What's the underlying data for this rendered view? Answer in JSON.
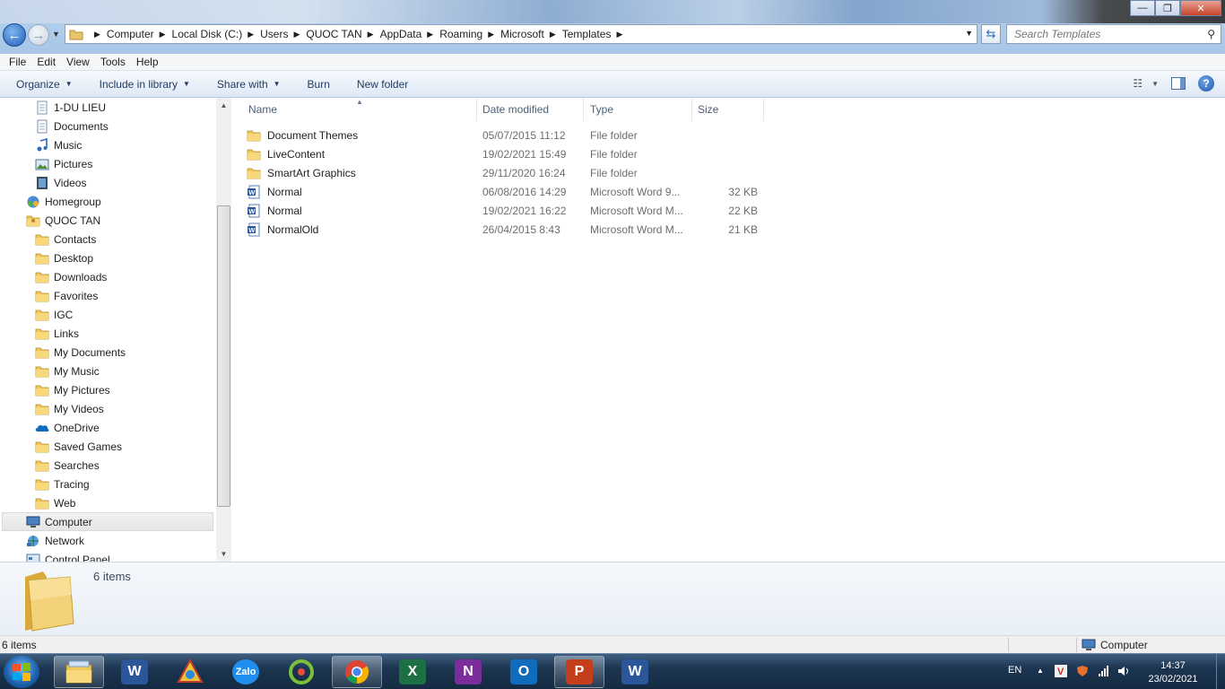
{
  "window": {
    "buttons": {
      "minimize": "—",
      "maximize": "❐",
      "close": "✕"
    }
  },
  "address": {
    "crumbs": [
      "Computer",
      "Local Disk (C:)",
      "Users",
      "QUOC TAN",
      "AppData",
      "Roaming",
      "Microsoft",
      "Templates"
    ]
  },
  "search": {
    "placeholder": "Search Templates"
  },
  "menu": [
    "File",
    "Edit",
    "View",
    "Tools",
    "Help"
  ],
  "commands": {
    "organize": "Organize",
    "include_in_library": "Include in library",
    "share_with": "Share with",
    "burn": "Burn",
    "new_folder": "New folder"
  },
  "nav": {
    "items": [
      {
        "label": "1-DU LIEU",
        "icon": "library-doc-icon",
        "indent": 2
      },
      {
        "label": "Documents",
        "icon": "documents-library-icon",
        "indent": 2
      },
      {
        "label": "Music",
        "icon": "music-library-icon",
        "indent": 2
      },
      {
        "label": "Pictures",
        "icon": "pictures-library-icon",
        "indent": 2
      },
      {
        "label": "Videos",
        "icon": "videos-library-icon",
        "indent": 2
      },
      {
        "label": "Homegroup",
        "icon": "homegroup-icon",
        "indent": 1
      },
      {
        "label": "QUOC TAN",
        "icon": "user-folder-icon",
        "indent": 1
      },
      {
        "label": "Contacts",
        "icon": "contacts-folder-icon",
        "indent": 2
      },
      {
        "label": "Desktop",
        "icon": "desktop-folder-icon",
        "indent": 2
      },
      {
        "label": "Downloads",
        "icon": "downloads-folder-icon",
        "indent": 2
      },
      {
        "label": "Favorites",
        "icon": "favorites-folder-icon",
        "indent": 2
      },
      {
        "label": "IGC",
        "icon": "folder-icon",
        "indent": 2
      },
      {
        "label": "Links",
        "icon": "links-folder-icon",
        "indent": 2
      },
      {
        "label": "My Documents",
        "icon": "my-documents-folder-icon",
        "indent": 2
      },
      {
        "label": "My Music",
        "icon": "my-music-folder-icon",
        "indent": 2
      },
      {
        "label": "My Pictures",
        "icon": "my-pictures-folder-icon",
        "indent": 2
      },
      {
        "label": "My Videos",
        "icon": "my-videos-folder-icon",
        "indent": 2
      },
      {
        "label": "OneDrive",
        "icon": "onedrive-icon",
        "indent": 2
      },
      {
        "label": "Saved Games",
        "icon": "saved-games-folder-icon",
        "indent": 2
      },
      {
        "label": "Searches",
        "icon": "searches-folder-icon",
        "indent": 2
      },
      {
        "label": "Tracing",
        "icon": "folder-icon",
        "indent": 2
      },
      {
        "label": "Web",
        "icon": "folder-icon",
        "indent": 2
      },
      {
        "label": "Computer",
        "icon": "computer-icon",
        "indent": 1,
        "selected": true
      },
      {
        "label": "Network",
        "icon": "network-icon",
        "indent": 1
      },
      {
        "label": "Control Panel",
        "icon": "control-panel-icon",
        "indent": 1
      }
    ]
  },
  "columns": {
    "name": "Name",
    "date": "Date modified",
    "type": "Type",
    "size": "Size"
  },
  "files": [
    {
      "name": "Document Themes",
      "date": "05/07/2015 11:12",
      "type": "File folder",
      "size": "",
      "icon": "folder-icon"
    },
    {
      "name": "LiveContent",
      "date": "19/02/2021 15:49",
      "type": "File folder",
      "size": "",
      "icon": "folder-icon"
    },
    {
      "name": "SmartArt Graphics",
      "date": "29/11/2020 16:24",
      "type": "File folder",
      "size": "",
      "icon": "folder-icon"
    },
    {
      "name": "Normal",
      "date": "06/08/2016 14:29",
      "type": "Microsoft Word 9...",
      "size": "32 KB",
      "icon": "word-document-icon"
    },
    {
      "name": "Normal",
      "date": "19/02/2021 16:22",
      "type": "Microsoft Word M...",
      "size": "22 KB",
      "icon": "word-document-icon"
    },
    {
      "name": "NormalOld",
      "date": "26/04/2015 8:43",
      "type": "Microsoft Word M...",
      "size": "21 KB",
      "icon": "word-document-icon"
    }
  ],
  "details": {
    "count": "6 items"
  },
  "status": {
    "left": "6 items",
    "right": "Computer"
  },
  "taskbar": {
    "apps": [
      {
        "name": "explorer",
        "icon": "explorer-icon",
        "active": true
      },
      {
        "name": "word-pinned",
        "icon": "word-icon",
        "letter": "W",
        "color": "#2b579a"
      },
      {
        "name": "unikey",
        "icon": "unikey-icon",
        "letter": "",
        "color": "#e8c23a"
      },
      {
        "name": "zalo",
        "icon": "zalo-icon",
        "letter": "Zalo",
        "color": "#1f8ef1"
      },
      {
        "name": "app-green",
        "icon": "green-app-icon",
        "letter": "",
        "color": "#7cbf3a"
      },
      {
        "name": "chrome",
        "icon": "chrome-icon",
        "active": true
      },
      {
        "name": "excel",
        "icon": "excel-icon",
        "letter": "X",
        "color": "#1d7044"
      },
      {
        "name": "onenote",
        "icon": "onenote-icon",
        "letter": "N",
        "color": "#7b2e9b"
      },
      {
        "name": "outlook",
        "icon": "outlook-icon",
        "letter": "O",
        "color": "#0f6cbd"
      },
      {
        "name": "powerpoint",
        "icon": "powerpoint-icon",
        "letter": "P",
        "color": "#c43e1c",
        "active": true
      },
      {
        "name": "word",
        "icon": "word-icon",
        "letter": "W",
        "color": "#2b579a"
      }
    ],
    "lang": "EN",
    "time": "14:37",
    "date": "23/02/2021"
  }
}
